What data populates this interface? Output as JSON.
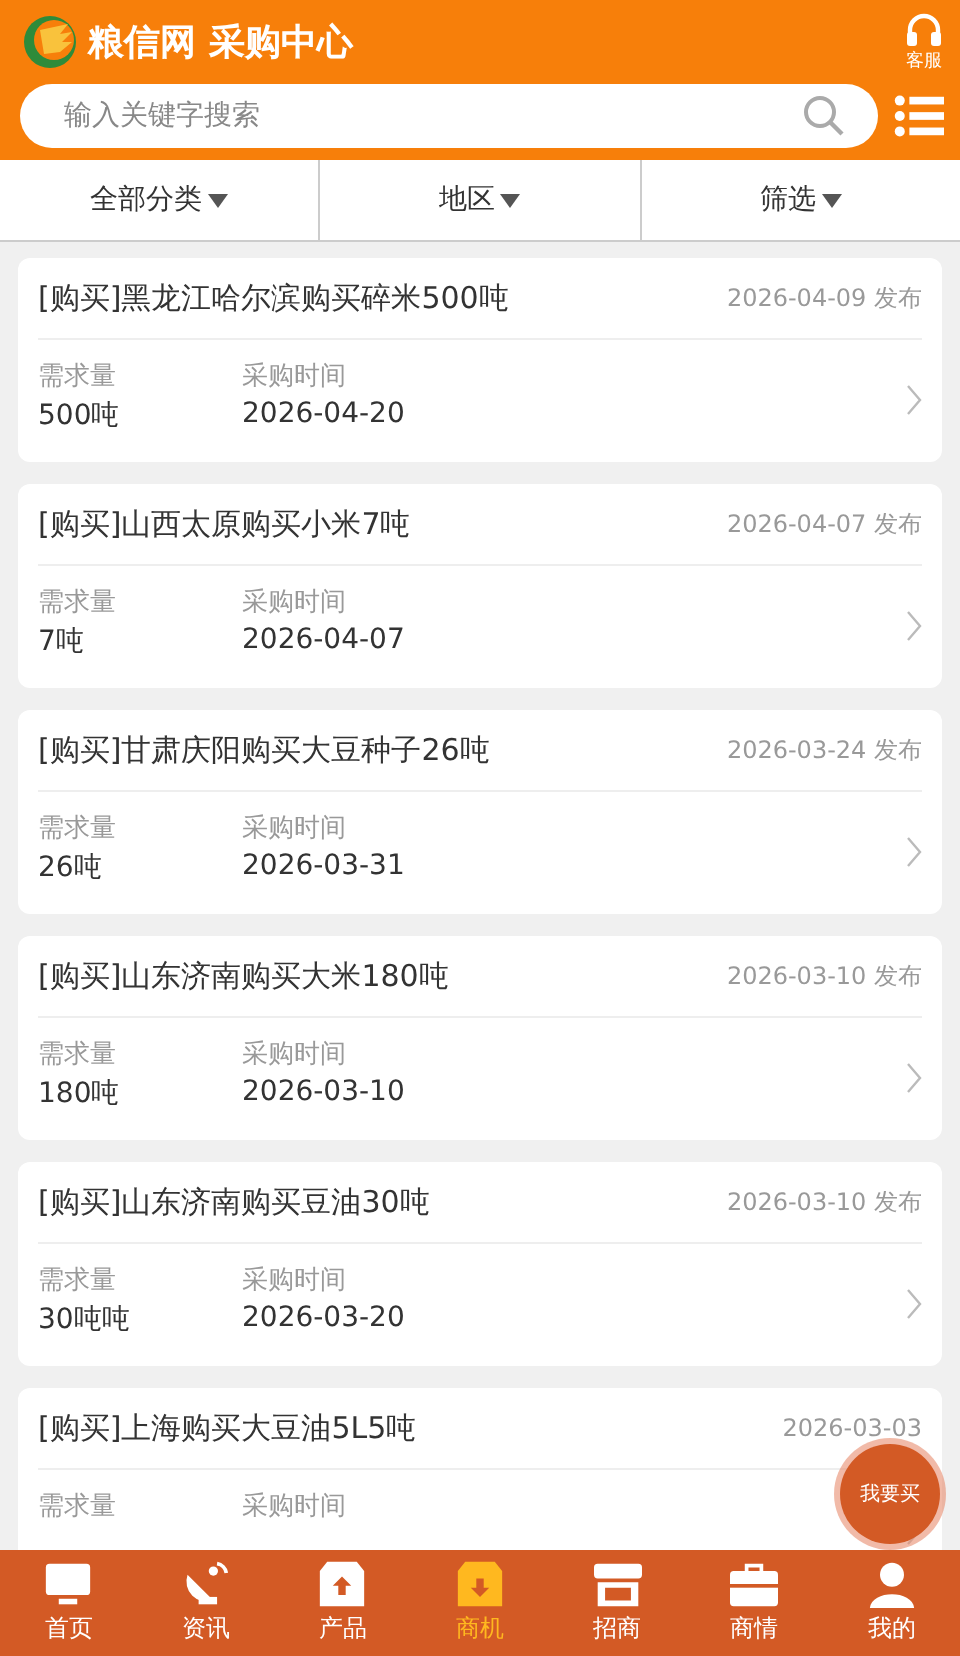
{
  "header": {
    "title": "粮信网 采购中心",
    "service_label": "客服"
  },
  "search": {
    "placeholder": "输入关键字搜索"
  },
  "filters": [
    {
      "label": "全部分类"
    },
    {
      "label": "地区"
    },
    {
      "label": "筛选"
    }
  ],
  "listings": [
    {
      "title": "[购买]黑龙江哈尔滨购买碎米500吨",
      "posted": "2026-04-09 发布",
      "quantity_label": "需求量",
      "quantity": "500吨",
      "date_label": "采购时间",
      "date": "2026-04-20"
    },
    {
      "title": "[购买]山西太原购买小米7吨",
      "posted": "2026-04-07 发布",
      "quantity_label": "需求量",
      "quantity": "7吨",
      "date_label": "采购时间",
      "date": "2026-04-07"
    },
    {
      "title": "[购买]甘肃庆阳购买大豆种子26吨",
      "posted": "2026-03-24 发布",
      "quantity_label": "需求量",
      "quantity": "26吨",
      "date_label": "采购时间",
      "date": "2026-03-31"
    },
    {
      "title": "[购买]山东济南购买大米180吨",
      "posted": "2026-03-10 发布",
      "quantity_label": "需求量",
      "quantity": "180吨",
      "date_label": "采购时间",
      "date": "2026-03-10"
    },
    {
      "title": "[购买]山东济南购买豆油30吨",
      "posted": "2026-03-10 发布",
      "quantity_label": "需求量",
      "quantity": "30吨吨",
      "date_label": "采购时间",
      "date": "2026-03-20"
    },
    {
      "title": "[购买]上海购买大豆油5L5吨",
      "posted": "2026-03-03",
      "quantity_label": "需求量",
      "date_label": "采购时间"
    }
  ],
  "float_button": {
    "label": "我要买"
  },
  "nav": [
    {
      "kind": "home",
      "label": "首页",
      "selected": false
    },
    {
      "kind": "news",
      "label": "资讯",
      "selected": false
    },
    {
      "kind": "product",
      "label": "产品",
      "selected": false
    },
    {
      "kind": "business",
      "label": "商机",
      "selected": true
    },
    {
      "kind": "shop",
      "label": "招商",
      "selected": false
    },
    {
      "kind": "market",
      "label": "商情",
      "selected": false
    },
    {
      "kind": "me",
      "label": "我的",
      "selected": false
    }
  ]
}
